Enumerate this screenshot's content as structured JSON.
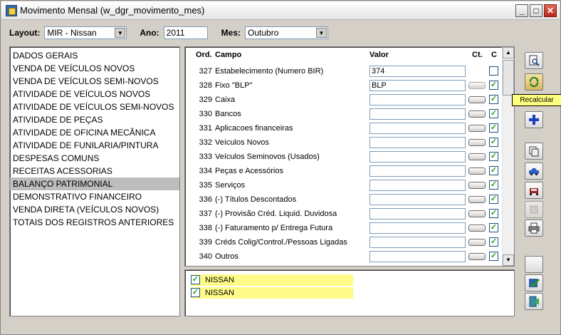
{
  "window": {
    "title": "Movimento Mensal (w_dgr_movimento_mes)"
  },
  "filters": {
    "layout_label": "Layout:",
    "layout_value": "MIR - Nissan",
    "ano_label": "Ano:",
    "ano_value": "2011",
    "mes_label": "Mes:",
    "mes_value": "Outubro"
  },
  "menu": {
    "items": [
      "DADOS GERAIS",
      "VENDA DE VEÍCULOS NOVOS",
      "VENDA DE VEÍCULOS SEMI-NOVOS",
      "ATIVIDADE DE VEÍCULOS NOVOS",
      "ATIVIDADE DE VEÍCULOS SEMI-NOVOS",
      "ATIVIDADE DE PEÇAS",
      "ATIVIDADE DE OFICINA MECÂNICA",
      "ATIVIDADE DE FUNILARIA/PINTURA",
      "DESPESAS COMUNS",
      "RECEITAS ACESSORIAS",
      "BALANÇO PATRIMONIAL",
      "DEMONSTRATIVO FINANCEIRO",
      "VENDA DIRETA (VEÍCULOS NOVOS)",
      "TOTAIS DOS REGISTROS ANTERIORES"
    ],
    "selected_index": 10
  },
  "grid": {
    "headers": {
      "ord": "Ord.",
      "campo": "Campo",
      "valor": "Valor",
      "ct": "Ct.",
      "c": "C"
    },
    "rows": [
      {
        "ord": "327",
        "campo": "Estabelecimento (Numero BIR)",
        "valor": "374",
        "ct": false,
        "checked": false
      },
      {
        "ord": "328",
        "campo": "Fixo \"BLP\"",
        "valor": "BLP",
        "ct": true,
        "ct_focused": true,
        "checked": true
      },
      {
        "ord": "329",
        "campo": "Caixa",
        "valor": "",
        "ct": true,
        "checked": true
      },
      {
        "ord": "330",
        "campo": "Bancos",
        "valor": "",
        "ct": true,
        "checked": true
      },
      {
        "ord": "331",
        "campo": "Aplicacoes financeiras",
        "valor": "",
        "ct": true,
        "checked": true
      },
      {
        "ord": "332",
        "campo": "Veículos Novos",
        "valor": "",
        "ct": true,
        "checked": true
      },
      {
        "ord": "333",
        "campo": "Veículos Seminovos (Usados)",
        "valor": "",
        "ct": true,
        "checked": true
      },
      {
        "ord": "334",
        "campo": "Peças e Acessórios",
        "valor": "",
        "ct": true,
        "checked": true
      },
      {
        "ord": "335",
        "campo": "Serviços",
        "valor": "",
        "ct": true,
        "checked": true
      },
      {
        "ord": "336",
        "campo": "(-) Títulos Descontados",
        "valor": "",
        "ct": true,
        "checked": true
      },
      {
        "ord": "337",
        "campo": "(-) Provisão Créd. Liquid. Duvidosa",
        "valor": "",
        "ct": true,
        "checked": true
      },
      {
        "ord": "338",
        "campo": "(-) Faturamento p/ Entrega Futura",
        "valor": "",
        "ct": true,
        "checked": true
      },
      {
        "ord": "339",
        "campo": "Créds Colig/Control./Pessoas Ligadas",
        "valor": "",
        "ct": true,
        "checked": true
      },
      {
        "ord": "340",
        "campo": "Outros",
        "valor": "",
        "ct": true,
        "checked": true
      }
    ]
  },
  "lower_list": {
    "items": [
      {
        "label": "NISSAN",
        "checked": true
      },
      {
        "label": "NISSAN",
        "checked": true
      }
    ]
  },
  "toolbar": {
    "buttons": [
      "preview-icon",
      "recalculate-icon",
      "add-icon",
      "copy-icon",
      "car-icon",
      "car-front-icon",
      "refresh-icon",
      "print-icon",
      "blank-icon",
      "save-check-icon",
      "exit-icon"
    ],
    "tooltip": "Recalcular"
  },
  "colors": {
    "highlight": "#fffb88",
    "selection": "#bdbdbd",
    "tooltip": "#ffff80",
    "check": "#21a121"
  }
}
